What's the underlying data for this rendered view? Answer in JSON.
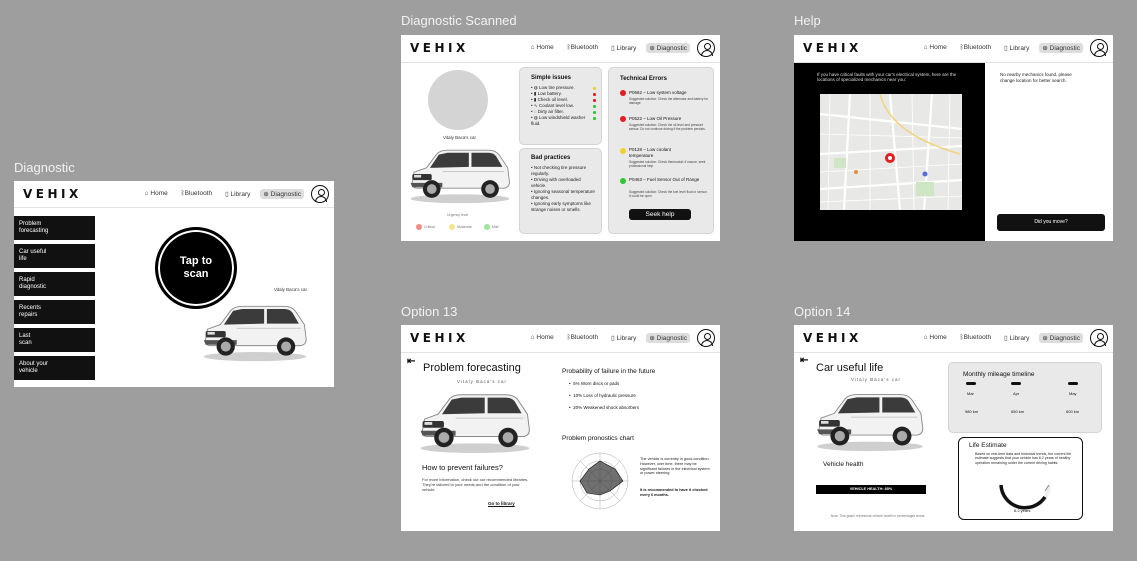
{
  "frames": {
    "diagnostic": "Diagnostic",
    "scanned": "Diagnostic Scanned",
    "help": "Help",
    "option13": "Option 13",
    "option14": "Option 14"
  },
  "nav": {
    "logo": "VEHIX",
    "home": "Home",
    "bluetooth": "Bluetooth",
    "library": "Library",
    "diagnostic": "Diagnostic"
  },
  "diagnostic": {
    "menu": [
      "Problem\nforecasting",
      "Car useful\nlife",
      "Rapid\ndiagnostic",
      "Recents\nrepairs",
      "Last\nscan",
      "About your\nvehicle"
    ],
    "scan_button": "Tap to\nscan",
    "car_owner": "Vitaly Baca's car"
  },
  "scanned": {
    "car_owner": "Vitaly Baca's car",
    "legend_title": "Urgency level",
    "legend": [
      "Critical",
      "Moderate",
      "Mild"
    ],
    "simple_title": "Simple issues",
    "simple_items": [
      "Low tire pressure.",
      "Low battery.",
      "Check oil level.",
      "Coolant level low.",
      "Dirty air filter.",
      "Low windshield washer fluid."
    ],
    "bad_title": "Bad practices",
    "bad_items": [
      "Not checking tire pressure regularly.",
      "Driving with overloaded vehicle.",
      "Ignoring seasonal temperature changes.",
      "Ignoring early symptoms like strange noises or smells."
    ],
    "tech_title": "Technical Errors",
    "errors": [
      {
        "code": "P0562 – Low system voltage",
        "text": "Suggested solution: Check the alternator and battery for damage.",
        "color": "#e41e1e"
      },
      {
        "code": "P0522 – Low Oil Pressure",
        "text": "Suggested solution: Check the oil level and pressure sensor. Do not continue driving if the problem persists.",
        "color": "#e41e1e"
      },
      {
        "code": "P0128 – Low coolant temperature",
        "text": "Suggested solution: Check thermostat; if unsure, seek professional help.",
        "color": "#f0d12a"
      },
      {
        "code": "P0463 – Fuel Sensor Out of Range",
        "text": "Suggested solution: Check the fuel level float or sensor. It could be open.",
        "color": "#2fc72f"
      }
    ],
    "seek_help": "Seek help"
  },
  "help": {
    "left_text": "If you have critical faults with your car's electrical system, here are the locations of specialized mechanics near you:",
    "right_text": "No nearby mechanics found, please change location for better search.",
    "moved_button": "Did you move?"
  },
  "option13": {
    "title": "Problem forecasting",
    "owner": "Vitaly Baca's car",
    "prevent_title": "How to prevent failures?",
    "prevent_text": "For more information, check out our recommended libraries. They're tailored to your needs and the condition of your vehicle.",
    "library_link": "Go to library",
    "prob_title": "Probability of failure in the future",
    "prob_items": [
      "5% Worn discs or pads",
      "10% Loss of hydraulic pressure",
      "20% Weakened shock absorbers"
    ],
    "chart_title": "Problem pronostics chart",
    "chart_text": "The vehicle is currently in good condition. However, over time, there may be significant failures in the electrical system or power steering.",
    "chart_note": "It is recommended to have it checked every 6 months."
  },
  "option14": {
    "title": "Car useful life",
    "owner": "Vitaly Baca's car",
    "health_label": "Vehicle health",
    "health_bar": "VEHICLE HEALTH: 85%",
    "footnote": "Note: This graph represents vehicle health in percentages terms.",
    "mileage_title": "Monthly mileage timeline",
    "months": [
      "Mar",
      "Apr",
      "May"
    ],
    "km": [
      "980 km",
      "650 km",
      "600 km"
    ],
    "life_title": "Life Estimate",
    "life_text": "Based on real-time data and historical trends, the current life estimate suggests that your vehicle has 6.2 years of healthy operation remaining under the current driving habits.",
    "years": "6.2 years"
  },
  "colors": {
    "critical": "#f28b82",
    "moderate": "#f5e58a",
    "mild": "#9be89b"
  }
}
